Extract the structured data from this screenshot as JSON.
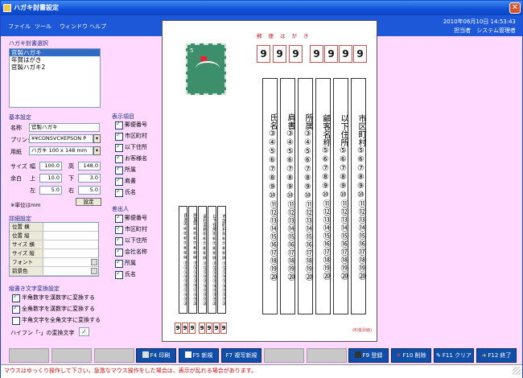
{
  "window": {
    "title": "ハガキ封書設定"
  },
  "menu": {
    "items": [
      "ファイル",
      "ツール",
      "ウィンドウ",
      "ヘルプ"
    ],
    "datetime": "2010年06月10日 14:53:43",
    "operator_label": "担当者",
    "operator": "システム管理者"
  },
  "select": {
    "group": "ハガキ封書選択",
    "items": [
      "官製ハガキ",
      "年賀はがき",
      "官製ハガキ2"
    ],
    "selected": 0
  },
  "basic": {
    "group": "基本設定",
    "name_label": "名称",
    "name_value": "官製ハガキ",
    "printer_label": "プリンタ",
    "printer_value": "¥¥CONSVC¥EPSON P",
    "paper_label": "用紙",
    "paper_value": "ハガキ 100 x 148 mm",
    "size_label": "サイズ",
    "width_label": "幅",
    "width_value": "100.0",
    "height_label": "高",
    "height_value": "148.0",
    "margin_label": "余白",
    "top_label": "上",
    "top_value": "10.0",
    "bottom_label": "下",
    "bottom_value": "3.0",
    "left_label": "左",
    "left_value": "5.0",
    "right_label": "右",
    "right_value": "5.0",
    "unit_note": "※単位はmm",
    "set_button": "設定"
  },
  "detail": {
    "group": "詳細設定",
    "rows": [
      "位置 横",
      "位置 縦",
      "サイズ 横",
      "サイズ 縦",
      "フォント",
      "前景色"
    ]
  },
  "vertical": {
    "group": "縦書き文字変換設定",
    "opt1": "半角数字を漢数字に変換する",
    "opt2": "全角数字を漢数字に変換する",
    "opt3": "半角文字を全角文字に変換する",
    "hyphen_label": "ハイフン「-」の変換文字",
    "hyphen_value": "ノ"
  },
  "display": {
    "group": "表示項目",
    "items": [
      {
        "label": "郵便番号",
        "on": true
      },
      {
        "label": "市区町村",
        "on": true
      },
      {
        "label": "以下住所",
        "on": true
      },
      {
        "label": "お客様名",
        "on": true
      },
      {
        "label": "所属",
        "on": true
      },
      {
        "label": "肩書",
        "on": true
      },
      {
        "label": "氏名",
        "on": true
      }
    ]
  },
  "sender": {
    "group": "差出人",
    "items": [
      {
        "label": "郵便番号",
        "on": true
      },
      {
        "label": "市区町村",
        "on": true
      },
      {
        "label": "以下住所",
        "on": true
      },
      {
        "label": "会社名称",
        "on": true
      },
      {
        "label": "所属",
        "on": true
      },
      {
        "label": "氏名",
        "on": true
      }
    ]
  },
  "preview": {
    "post_label": "郵便はがき",
    "zip": [
      "9",
      "9",
      "9",
      "9",
      "9",
      "9",
      "9"
    ],
    "columns": [
      "氏名③④⑤⑥⑦⑧⑨⑩⑪⑫⑬⑭⑮⑯⑰⑱⑲⑳",
      "肩書③④⑤⑥⑦⑧⑨⑩⑪⑫⑬⑭⑮⑯⑰⑱⑲⑳",
      "所属③④⑤⑥⑦⑧⑨⑩⑪⑫⑬⑭⑮⑯⑰⑱⑲⑳",
      "顧客名称⑤⑥⑦⑧⑨⑩⑪⑫⑬⑭⑮⑯⑰⑱⑲⑳",
      "以下住所⑤⑥⑦⑧⑨⑩⑪⑫⑬⑭⑮⑯⑰⑱⑲⑳",
      "市区町村⑤⑥⑦⑧⑨⑩⑪⑫⑬⑭⑮⑯⑰⑱⑲⑳"
    ],
    "sender_columns": [
      "氏名③④⑤⑥⑦⑧⑨⑩⑪⑫⑬⑭⑮⑯⑰⑱⑲⑳",
      "所属③④⑤⑥⑦⑧⑨⑩⑪⑫⑬⑭⑮⑯⑰⑱⑲⑳",
      "会社名称⑤⑥⑦⑧⑨⑩⑪⑫⑬⑭⑮⑯⑰⑱⑲⑳",
      "以下住所⑤⑥⑦⑧⑨⑩⑪⑫⑬⑭⑮⑯⑰⑱⑲⑳",
      "市区町村⑤⑥⑦⑧⑨⑩⑪⑫⑬⑭⑮⑯⑰⑱⑲⑳"
    ],
    "sender_zip": [
      "9",
      "9",
      "9",
      "9",
      "9",
      "9",
      "9"
    ],
    "seal": "(料金別納)"
  },
  "fkeys": {
    "f4": "F4 印刷",
    "f5": "F5 新規",
    "f7": "F7 複写新規",
    "f9": "F9 登録",
    "f10": "F10 削除",
    "f11": "F11 クリア",
    "f12": "F12 終了"
  },
  "status": "マウスはゆっくり操作して下さい。急激なマウス操作をした場合は、表示が乱れる場合があります。",
  "colors": {
    "accent": "#1d58d8",
    "status_text": "#d01010",
    "bg": "#ffd9ff"
  }
}
